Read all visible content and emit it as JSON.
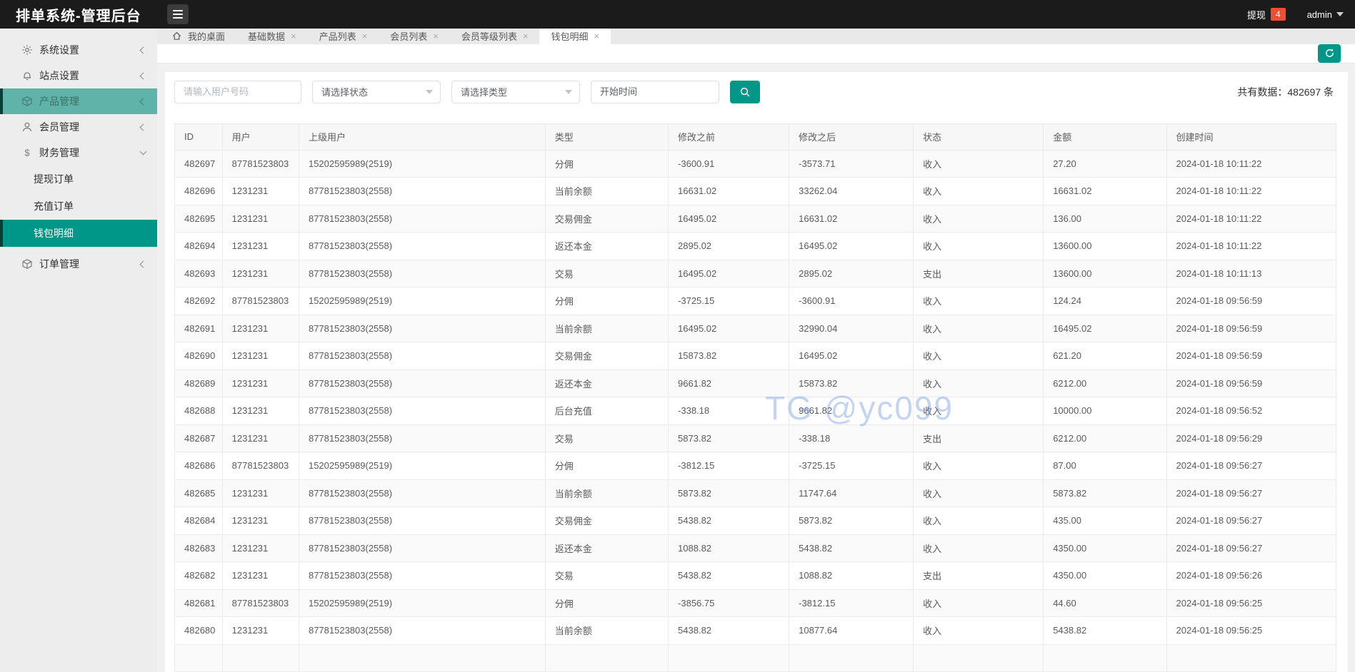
{
  "topbar": {
    "title": "排单系统-管理后台",
    "withdraw_label": "提现",
    "withdraw_badge": "4",
    "user": "admin"
  },
  "tabs": [
    {
      "label": "我的桌面",
      "icon": "home",
      "closable": false,
      "active": false
    },
    {
      "label": "基础数据",
      "closable": true,
      "active": false
    },
    {
      "label": "产品列表",
      "closable": true,
      "active": false
    },
    {
      "label": "会员列表",
      "closable": true,
      "active": false
    },
    {
      "label": "会员等级列表",
      "closable": true,
      "active": false
    },
    {
      "label": "钱包明细",
      "closable": true,
      "active": true
    }
  ],
  "sidebar": {
    "items": [
      {
        "label": "系统设置",
        "icon": "gear",
        "chevron": "left",
        "highlight": false
      },
      {
        "label": "站点设置",
        "icon": "bell",
        "chevron": "left",
        "highlight": false
      },
      {
        "label": "产品管理",
        "icon": "box",
        "chevron": "left",
        "highlight": true
      },
      {
        "label": "会员管理",
        "icon": "user",
        "chevron": "left",
        "highlight": false
      },
      {
        "label": "财务管理",
        "icon": "dollar",
        "chevron": "down",
        "highlight": false,
        "children": [
          {
            "label": "提现订单",
            "active": false
          },
          {
            "label": "充值订单",
            "active": false
          },
          {
            "label": "钱包明细",
            "active": true
          }
        ]
      },
      {
        "label": "订单管理",
        "icon": "cube",
        "chevron": "left",
        "highlight": false,
        "gap": true
      }
    ]
  },
  "filters": {
    "user_placeholder": "请输入用户号码",
    "status_placeholder": "请选择状态",
    "type_placeholder": "请选择类型",
    "time_placeholder": "开始时间",
    "total_text": "共有数据：482697 条"
  },
  "table": {
    "headers": [
      "ID",
      "用户",
      "上级用户",
      "类型",
      "修改之前",
      "修改之后",
      "状态",
      "金额",
      "创建时间"
    ],
    "rows": [
      [
        "482697",
        "87781523803",
        "15202595989(2519)",
        "分佣",
        "-3600.91",
        "-3573.71",
        "收入",
        "27.20",
        "2024-01-18 10:11:22"
      ],
      [
        "482696",
        "1231231",
        "87781523803(2558)",
        "当前余额",
        "16631.02",
        "33262.04",
        "收入",
        "16631.02",
        "2024-01-18 10:11:22"
      ],
      [
        "482695",
        "1231231",
        "87781523803(2558)",
        "交易佣金",
        "16495.02",
        "16631.02",
        "收入",
        "136.00",
        "2024-01-18 10:11:22"
      ],
      [
        "482694",
        "1231231",
        "87781523803(2558)",
        "返还本金",
        "2895.02",
        "16495.02",
        "收入",
        "13600.00",
        "2024-01-18 10:11:22"
      ],
      [
        "482693",
        "1231231",
        "87781523803(2558)",
        "交易",
        "16495.02",
        "2895.02",
        "支出",
        "13600.00",
        "2024-01-18 10:11:13"
      ],
      [
        "482692",
        "87781523803",
        "15202595989(2519)",
        "分佣",
        "-3725.15",
        "-3600.91",
        "收入",
        "124.24",
        "2024-01-18 09:56:59"
      ],
      [
        "482691",
        "1231231",
        "87781523803(2558)",
        "当前余额",
        "16495.02",
        "32990.04",
        "收入",
        "16495.02",
        "2024-01-18 09:56:59"
      ],
      [
        "482690",
        "1231231",
        "87781523803(2558)",
        "交易佣金",
        "15873.82",
        "16495.02",
        "收入",
        "621.20",
        "2024-01-18 09:56:59"
      ],
      [
        "482689",
        "1231231",
        "87781523803(2558)",
        "返还本金",
        "9661.82",
        "15873.82",
        "收入",
        "6212.00",
        "2024-01-18 09:56:59"
      ],
      [
        "482688",
        "1231231",
        "87781523803(2558)",
        "后台充值",
        "-338.18",
        "9661.82",
        "收入",
        "10000.00",
        "2024-01-18 09:56:52"
      ],
      [
        "482687",
        "1231231",
        "87781523803(2558)",
        "交易",
        "5873.82",
        "-338.18",
        "支出",
        "6212.00",
        "2024-01-18 09:56:29"
      ],
      [
        "482686",
        "87781523803",
        "15202595989(2519)",
        "分佣",
        "-3812.15",
        "-3725.15",
        "收入",
        "87.00",
        "2024-01-18 09:56:27"
      ],
      [
        "482685",
        "1231231",
        "87781523803(2558)",
        "当前余额",
        "5873.82",
        "11747.64",
        "收入",
        "5873.82",
        "2024-01-18 09:56:27"
      ],
      [
        "482684",
        "1231231",
        "87781523803(2558)",
        "交易佣金",
        "5438.82",
        "5873.82",
        "收入",
        "435.00",
        "2024-01-18 09:56:27"
      ],
      [
        "482683",
        "1231231",
        "87781523803(2558)",
        "返还本金",
        "1088.82",
        "5438.82",
        "收入",
        "4350.00",
        "2024-01-18 09:56:27"
      ],
      [
        "482682",
        "1231231",
        "87781523803(2558)",
        "交易",
        "5438.82",
        "1088.82",
        "支出",
        "4350.00",
        "2024-01-18 09:56:26"
      ],
      [
        "482681",
        "87781523803",
        "15202595989(2519)",
        "分佣",
        "-3856.75",
        "-3812.15",
        "收入",
        "44.60",
        "2024-01-18 09:56:25"
      ],
      [
        "482680",
        "1231231",
        "87781523803(2558)",
        "当前余额",
        "5438.82",
        "10877.64",
        "收入",
        "5438.82",
        "2024-01-18 09:56:25"
      ]
    ],
    "partial_bottom_row": true
  },
  "watermark": "TG @yc099",
  "colors": {
    "accent": "#009688",
    "badge": "#ef4f2e",
    "watermark": "#7aa0e0"
  }
}
